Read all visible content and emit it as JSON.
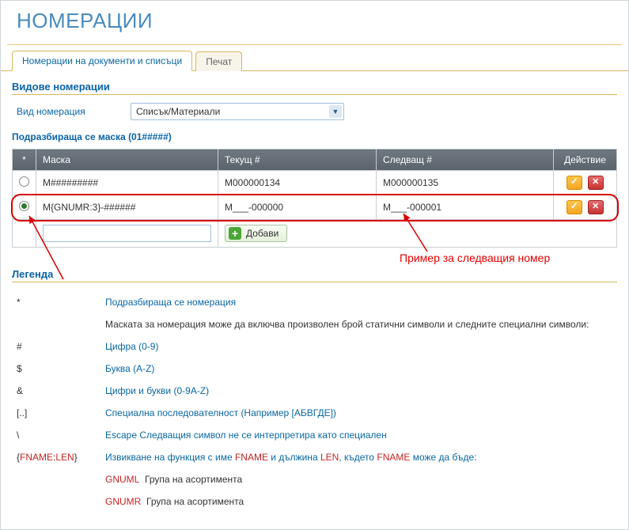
{
  "page_title": "НОМЕРАЦИИ",
  "tabs": [
    {
      "label": "Номерации на документи и списъци",
      "active": true
    },
    {
      "label": "Печат",
      "active": false
    }
  ],
  "sections": {
    "types_title": "Видове номерации",
    "type_label": "Вид номерация",
    "type_value": "Списък/Материали",
    "mask_title": "Подразбираща се маска (01#####)"
  },
  "grid": {
    "headers": {
      "star": "*",
      "mask": "Маска",
      "current": "Текущ #",
      "next": "Следващ #",
      "action": "Действие"
    },
    "rows": [
      {
        "selected": false,
        "mask": "M#########",
        "current": "M000000134",
        "next": "M000000135"
      },
      {
        "selected": true,
        "mask": "M{GNUMR:3}-######",
        "current": "M___-000000",
        "next": "M___-000001"
      }
    ],
    "add_label": "Добави"
  },
  "annotation": "Пример за следващия номер",
  "legend": {
    "title": "Легенда",
    "rows": [
      {
        "sym": "*",
        "text": "Подразбираща се номерация"
      },
      {
        "sym": "",
        "text": "Маската за номерация може да включва произволен брой статични символи и следните специални символи:",
        "plain": true
      },
      {
        "sym": "#",
        "text": "Цифра (0-9)"
      },
      {
        "sym": "$",
        "text": "Буква (A-Z)"
      },
      {
        "sym": "&",
        "text": "Цифри и букви (0-9A-Z)"
      },
      {
        "sym": "[..]",
        "text": "Специална последователност (Например [АБВГДЕ])"
      },
      {
        "sym": "\\",
        "text": "Escape Следващия символ не се интерпретира като специален"
      }
    ],
    "fname_sym_open": "{",
    "fname_sym_name": "FNAME",
    "fname_sym_sep": ":",
    "fname_sym_len": "LEN",
    "fname_sym_close": "}",
    "fname_text_a": "Извикване на функция с име ",
    "fname_text_b": " и дължина ",
    "fname_text_c": ", където ",
    "fname_text_d": " може да бъде:",
    "fname_name": "FNAME",
    "fname_len": "LEN",
    "funcs": [
      {
        "name": "GNUML",
        "desc": "Група на асортимента"
      },
      {
        "name": "GNUMR",
        "desc": "Група на асортимента"
      }
    ]
  }
}
